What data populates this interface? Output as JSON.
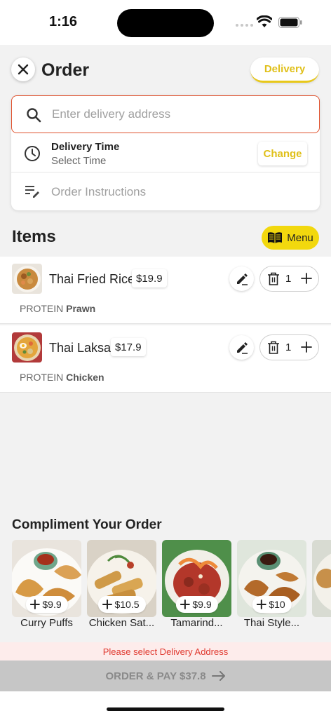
{
  "status": {
    "time": "1:16"
  },
  "header": {
    "title": "Order",
    "mode_label": "Delivery"
  },
  "delivery": {
    "address_placeholder": "Enter delivery address",
    "time_title": "Delivery Time",
    "time_value": "Select Time",
    "change_label": "Change",
    "instructions_placeholder": "Order Instructions"
  },
  "items_section": {
    "title": "Items",
    "menu_label": "Menu"
  },
  "items": [
    {
      "name": "Thai Fried Rice",
      "price": "$19.9",
      "qty": "1",
      "option_label": "PROTEIN",
      "option_value": "Prawn"
    },
    {
      "name": "Thai Laksa",
      "price": "$17.9",
      "qty": "1",
      "option_label": "PROTEIN",
      "option_value": "Chicken"
    }
  ],
  "compliment": {
    "title": "Compliment Your Order",
    "products": [
      {
        "name": "Curry Puffs",
        "price": "$9.9"
      },
      {
        "name": "Chicken Sat...",
        "price": "$10.5"
      },
      {
        "name": "Tamarind...",
        "price": "$9.9"
      },
      {
        "name": "Thai Style...",
        "price": "$10"
      }
    ]
  },
  "footer": {
    "warning": "Please select Delivery Address",
    "pay_label": "ORDER & PAY $37.8"
  },
  "colors": {
    "accent_yellow": "#f2d80e",
    "error_red": "#e0392f",
    "address_border": "#e0532f"
  },
  "icons": [
    "close-icon",
    "search-icon",
    "clock-icon",
    "notes-icon",
    "menu-book-icon",
    "edit-icon",
    "trash-icon",
    "plus-icon",
    "arrow-right-icon",
    "wifi-icon",
    "battery-icon"
  ]
}
